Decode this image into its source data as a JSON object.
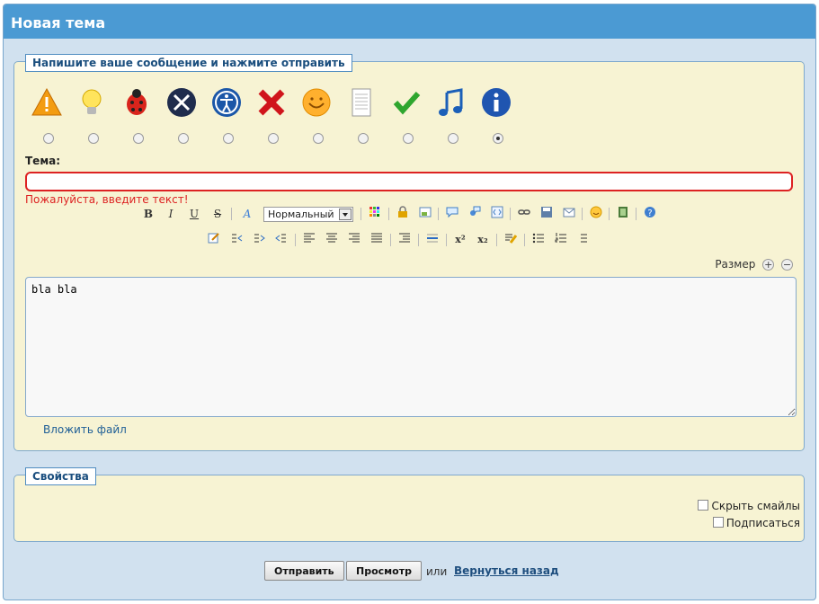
{
  "window": {
    "title": "Новая тема"
  },
  "message": {
    "legend": "Напишите ваше сообщение и нажмите отправить",
    "post_icons": [
      {
        "icon": "warning-icon"
      },
      {
        "icon": "lightbulb-icon"
      },
      {
        "icon": "bug-icon"
      },
      {
        "icon": "tools-icon"
      },
      {
        "icon": "accessibility-icon"
      },
      {
        "icon": "cross-icon"
      },
      {
        "icon": "smiley-icon"
      },
      {
        "icon": "document-icon"
      },
      {
        "icon": "checkmark-icon"
      },
      {
        "icon": "music-note-icon"
      },
      {
        "icon": "info-icon"
      }
    ],
    "selected_icon_index": 10,
    "subject_label": "Тема:",
    "subject_value": "",
    "error": "Пожалуйста, введите текст!",
    "font_size_select": "Нормальный",
    "size_label": "Размер",
    "body": "bla bla",
    "attach_link": "Вложить файл"
  },
  "properties": {
    "legend": "Свойства",
    "hide_smileys": "Скрыть смайлы",
    "sign": "Подписаться"
  },
  "actions": {
    "submit": "Отправить",
    "preview": "Просмотр",
    "or": "или",
    "back": "Вернуться назад"
  },
  "colors": {
    "titlebar": "#4b9ad3",
    "panel": "#f7f3d3",
    "error": "#dd2222",
    "link": "#1e5e96"
  }
}
